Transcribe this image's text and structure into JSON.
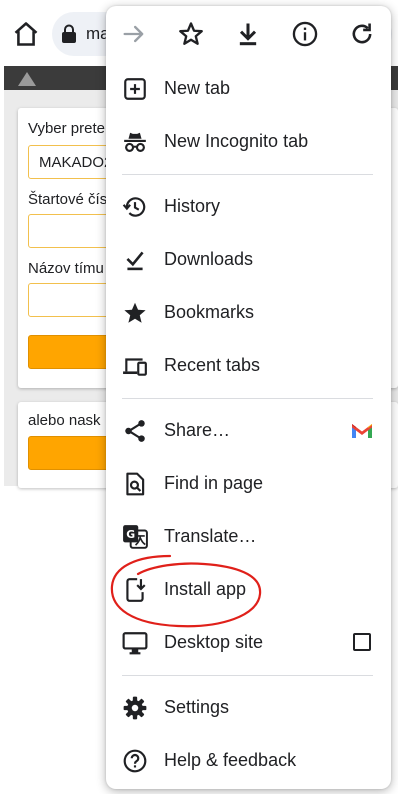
{
  "browser": {
    "url_partial": "ma",
    "colors": {
      "omnibox": "#eef1f6",
      "icons": "#202124"
    }
  },
  "page": {
    "form": {
      "field1_label": "Vyber prete",
      "field1_value": "MAKADO2",
      "field2_label": "Štartové čís",
      "field3_label": "Názov tímu",
      "alt_label": "alebo nask"
    },
    "colors": {
      "accent": "#ffa500",
      "input_border": "#f2c04d",
      "header": "#3b3b3b"
    }
  },
  "menu": {
    "toolbar": [
      {
        "icon": "forward-arrow-icon",
        "enabled": false
      },
      {
        "icon": "star-icon"
      },
      {
        "icon": "download-icon"
      },
      {
        "icon": "info-icon"
      },
      {
        "icon": "refresh-icon"
      }
    ],
    "items": {
      "new_tab": "New tab",
      "new_incognito_tab": "New Incognito tab",
      "history": "History",
      "downloads": "Downloads",
      "bookmarks": "Bookmarks",
      "recent_tabs": "Recent tabs",
      "share": "Share…",
      "find_in_page": "Find in page",
      "translate": "Translate…",
      "install_app": "Install app",
      "desktop_site": "Desktop site",
      "settings": "Settings",
      "help_feedback": "Help & feedback"
    },
    "desktop_site_checked": false,
    "annotation_color": "#e0201a"
  }
}
